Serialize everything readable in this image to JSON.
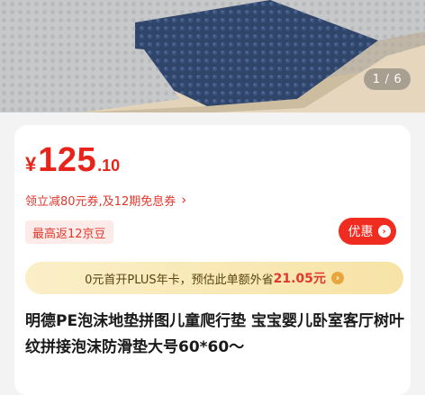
{
  "gallery": {
    "current": "1",
    "total": "6",
    "separator": "/"
  },
  "product": {
    "price": {
      "currency": "¥",
      "integer": "125",
      "decimal": ".10"
    },
    "coupon_text": "领立减80元券,及12期免息券",
    "coupon_chevron": "›",
    "jd_bean_tag": "最高返12京豆",
    "promo_button_label": "优惠",
    "plus": {
      "prefix": "0元首开PLUS年卡，预估此单额外省",
      "amount": "21.05元"
    },
    "title": "明德PE泡沫地垫拼图儿童爬行垫 宝宝婴儿卧室客厅树叶纹拼接泡沫防滑垫大号60*60～"
  },
  "colors": {
    "price_red": "#e8231a",
    "promo_button": "#f02b1f",
    "plus_bar": "#f7e3a6",
    "mat_navy": "#2e4266",
    "mat_grey": "#c4c5c6",
    "floor_wood": "#e4d4ba"
  },
  "icons": {
    "promo_arrow": "chevron-right-circle-icon",
    "plus_arrow": "chevron-right-circle-icon"
  }
}
